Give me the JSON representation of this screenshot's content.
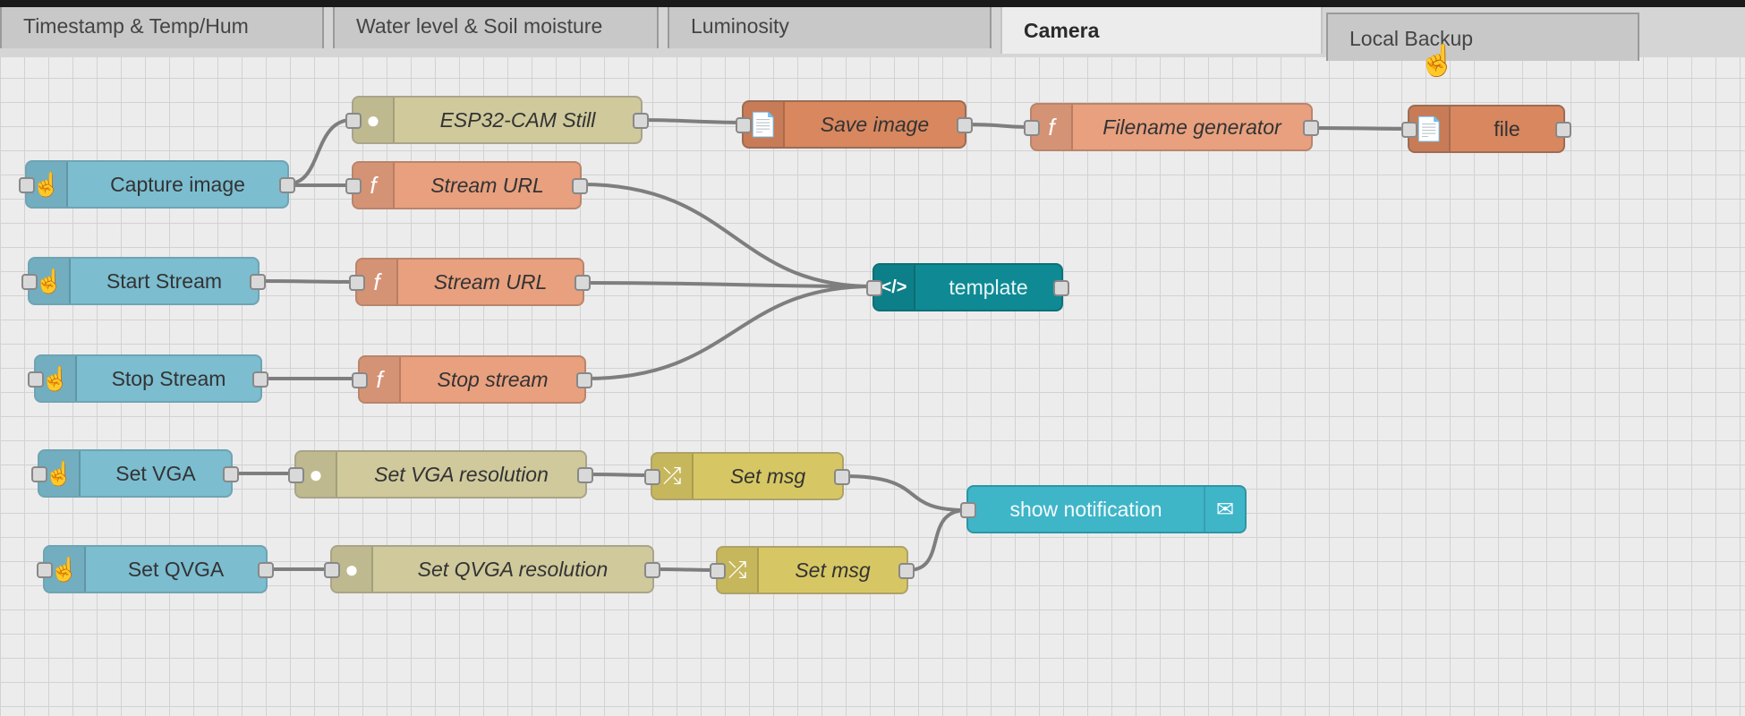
{
  "tabs": [
    {
      "label": "Timestamp & Temp/Hum",
      "active": false
    },
    {
      "label": "Water level & Soil moisture",
      "active": false
    },
    {
      "label": "Luminosity",
      "active": false
    },
    {
      "label": "Camera",
      "active": true
    },
    {
      "label": "Local Backup",
      "active": false
    }
  ],
  "nodes": {
    "capture_image": {
      "label": "Capture image",
      "icon": "hand-pointer-icon"
    },
    "esp32_cam_still": {
      "label": "ESP32-CAM Still",
      "icon": "globe-icon"
    },
    "stream_url_1": {
      "label": "Stream URL",
      "icon": "function-icon"
    },
    "save_image": {
      "label": "Save image",
      "icon": "file-icon"
    },
    "filename_generator": {
      "label": "Filename generator",
      "icon": "function-icon"
    },
    "file": {
      "label": "file",
      "icon": "file-icon"
    },
    "start_stream": {
      "label": "Start Stream",
      "icon": "hand-pointer-icon"
    },
    "stream_url_2": {
      "label": "Stream URL",
      "icon": "function-icon"
    },
    "template": {
      "label": "template",
      "icon": "code-icon"
    },
    "stop_stream_button": {
      "label": "Stop Stream",
      "icon": "hand-pointer-icon"
    },
    "stop_stream_func": {
      "label": "Stop stream",
      "icon": "function-icon"
    },
    "set_vga": {
      "label": "Set VGA",
      "icon": "hand-pointer-icon"
    },
    "set_vga_resolution": {
      "label": "Set VGA resolution",
      "icon": "globe-icon"
    },
    "set_msg_1": {
      "label": "Set msg",
      "icon": "shuffle-icon"
    },
    "show_notification": {
      "label": "show notification",
      "icon": "envelope-icon"
    },
    "set_qvga": {
      "label": "Set QVGA",
      "icon": "hand-pointer-icon"
    },
    "set_qvga_resolution": {
      "label": "Set QVGA resolution",
      "icon": "globe-icon"
    },
    "set_msg_2": {
      "label": "Set msg",
      "icon": "shuffle-icon"
    }
  },
  "colors": {
    "inject": "#7cbdd0",
    "function": "#e8a07f",
    "http_request": "#cfc99c",
    "file": "#d8875f",
    "template": "#0f8a94",
    "change": "#d7c764",
    "notification": "#3fb5c8"
  }
}
